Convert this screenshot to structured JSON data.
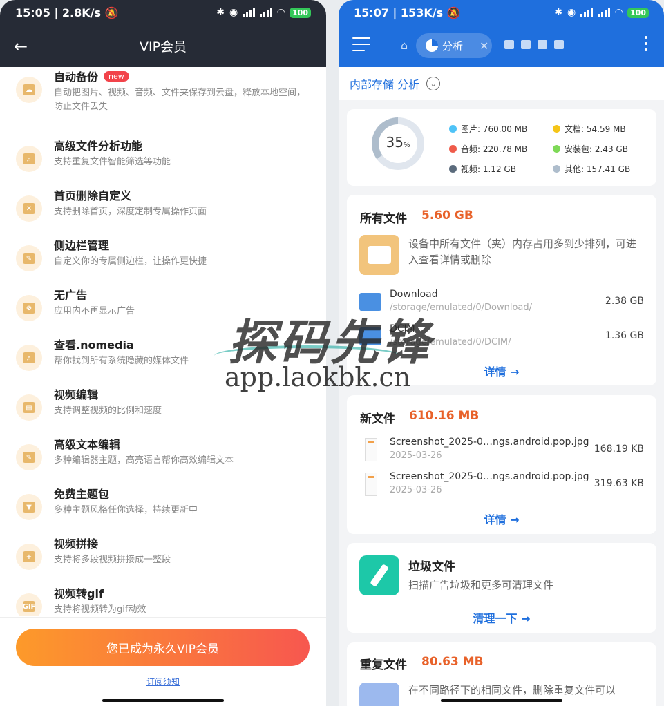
{
  "left": {
    "status": {
      "time": "15:05",
      "speed": "2.8K/s",
      "battery": "100"
    },
    "header": {
      "title": "VIP会员"
    },
    "features": [
      {
        "name": "自动备份",
        "badge": "new",
        "desc": "自动把图片、视频、音频、文件夹保存到云盘，释放本地空间，防止文件丢失"
      },
      {
        "name": "高级文件分析功能",
        "desc": "支持重复文件智能筛选等功能"
      },
      {
        "name": "首页删除自定义",
        "desc": "支持删除首页，深度定制专属操作页面"
      },
      {
        "name": "侧边栏管理",
        "desc": "自定义你的专属侧边栏，让操作更快捷"
      },
      {
        "name": "无广告",
        "desc": "应用内不再显示广告"
      },
      {
        "name": "查看.nomedia",
        "desc": "帮你找到所有系统隐藏的媒体文件"
      },
      {
        "name": "视频编辑",
        "desc": "支持调整视频的比例和速度"
      },
      {
        "name": "高级文本编辑",
        "desc": "多种编辑器主题，高亮语言帮你高效编辑文本"
      },
      {
        "name": "免费主题包",
        "desc": "多种主题风格任你选择，持续更新中"
      },
      {
        "name": "视频拼接",
        "desc": "支持将多段视频拼接成一整段"
      },
      {
        "name": "视频转gif",
        "desc": "支持将视频转为gif动效"
      }
    ],
    "vip_button": "您已成为永久VIP会员",
    "notice_link": "订阅须知"
  },
  "right": {
    "status": {
      "time": "15:07",
      "speed": "153K/s",
      "battery": "100"
    },
    "tab": {
      "label": "分析"
    },
    "breadcrumb": "内部存储 分析",
    "usage": {
      "percent": "35",
      "percent_unit": "%",
      "used_fraction": 0.35,
      "legend": [
        {
          "label": "图片: 760.00 MB",
          "color": "#4fc3f7"
        },
        {
          "label": "文档: 54.59 MB",
          "color": "#f5c518"
        },
        {
          "label": "音频: 220.78 MB",
          "color": "#ef5b4a"
        },
        {
          "label": "安装包: 2.43 GB",
          "color": "#7ed957"
        },
        {
          "label": "视频: 1.12 GB",
          "color": "#5b6b7c"
        },
        {
          "label": "其他: 157.41 GB",
          "color": "#aebdcc"
        }
      ]
    },
    "all_files": {
      "title": "所有文件",
      "size": "5.60 GB",
      "desc": "设备中所有文件（夹）内存占用多到少排列，可进入查看详情或删除",
      "items": [
        {
          "name": "Download",
          "path": "/storage/emulated/0/Download/",
          "size": "2.38 GB"
        },
        {
          "name": "DCIM",
          "path": "/storage/emulated/0/DCIM/",
          "size": "1.36 GB"
        }
      ],
      "detail": "详情 →"
    },
    "new_files": {
      "title": "新文件",
      "size": "610.16 MB",
      "items": [
        {
          "name": "Screenshot_2025-0…ngs.android.pop.jpg",
          "date": "2025-03-26",
          "size": "168.19 KB"
        },
        {
          "name": "Screenshot_2025-0…ngs.android.pop.jpg",
          "date": "2025-03-26",
          "size": "319.63 KB"
        }
      ],
      "detail": "详情 →"
    },
    "junk": {
      "title": "垃圾文件",
      "desc": "扫描广告垃圾和更多可清理文件",
      "action": "清理一下 →"
    },
    "duplicates": {
      "title": "重复文件",
      "size": "80.63 MB",
      "desc": "在不同路径下的相同文件，删除重复文件可以"
    }
  },
  "watermark": {
    "line1": "探码先锋",
    "line2": "app.laokbk.cn"
  }
}
